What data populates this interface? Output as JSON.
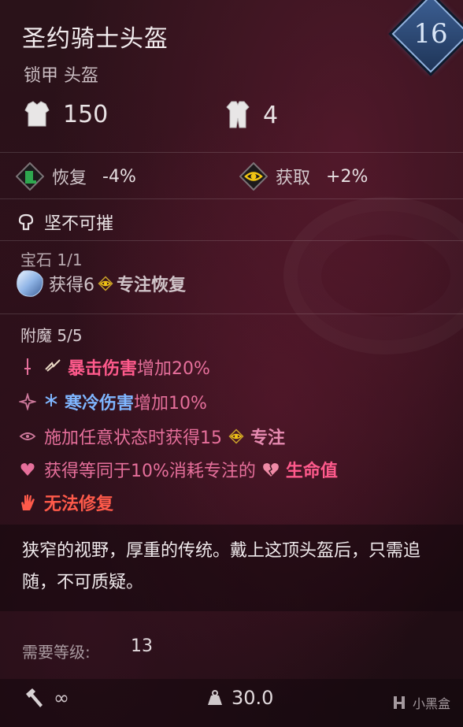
{
  "item": {
    "name": "圣约骑士头盔",
    "type": "锁甲 头盔",
    "level": "16"
  },
  "stats": {
    "armor": "150",
    "weight_class": "4"
  },
  "modifiers": [
    {
      "label": "恢复",
      "value": "-4%",
      "icon": "recovery-icon"
    },
    {
      "label": "获取",
      "value": "+2%",
      "icon": "focus-gain-icon"
    }
  ],
  "perk": {
    "label": "坚不可摧",
    "icon": "indestructible-icon"
  },
  "gem": {
    "header": "宝石 1/1",
    "prefix": "获得6",
    "suffix": "专注恢复",
    "icon": "gem-icon"
  },
  "enchant": {
    "header": "附魔 5/5",
    "lines": [
      {
        "highlight": "暴击伤害",
        "text": "增加20%"
      },
      {
        "highlight": "寒冷伤害",
        "text": "增加10%"
      },
      {
        "text": "施加任意状态时获得15",
        "highlight": "专注"
      },
      {
        "text": "获得等同于10%消耗专注的",
        "highlight": "生命值"
      },
      {
        "highlight": "无法修复"
      }
    ]
  },
  "description": "狭窄的视野，厚重的传统。戴上这顶头盔后，只需追随，不可质疑。",
  "requirement": {
    "label": "需要等级:",
    "value": "13"
  },
  "footer": {
    "durability": "∞",
    "weight": "30.0",
    "watermark": "小黑盒"
  },
  "colors": {
    "background": "#2a1219",
    "crit": "#ff5a8c",
    "cold": "#7fb6ff",
    "focus": "#e68ab0",
    "unrepairable": "#ff5a4a",
    "level_badge": "#3c5f93"
  }
}
